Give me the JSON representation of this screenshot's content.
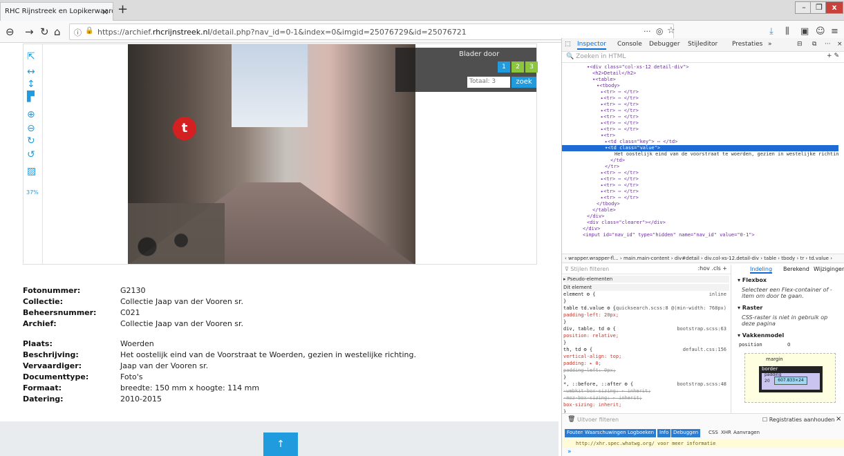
{
  "browser": {
    "tab_title": "RHC Rijnstreek en Lopikerwaard - D",
    "tab_close": "×",
    "new_tab": "+",
    "url_prefix": "https://archief.",
    "url_domain": "rhcrijnstreek.nl",
    "url_path": "/detail.php?nav_id=0-1&index=0&imgid=25076729&id=25076721",
    "page_actions": "···",
    "window": {
      "minimize": "–",
      "maximize": "❐",
      "close": "x"
    }
  },
  "viewer": {
    "zoom": "37%",
    "pager_title": "Blader door",
    "pages": [
      "1",
      "2",
      "3"
    ],
    "totaal": "Totaal: 3",
    "zoek": "zoek",
    "sign_letter": "t"
  },
  "details": [
    {
      "key": "Fotonummer:",
      "value": "G2130"
    },
    {
      "key": "Collectie:",
      "value": "Collectie Jaap van der Vooren sr."
    },
    {
      "key": "Beheersnummer:",
      "value": "C021"
    },
    {
      "key": "Archief:",
      "value": "Collectie Jaap van der Vooren sr."
    },
    {
      "key": "Plaats:",
      "value": "Woerden"
    },
    {
      "key": "Beschrijving:",
      "value": "Het oostelijk eind van de Voorstraat te Woerden, gezien in westelijke richting."
    },
    {
      "key": "Vervaardiger:",
      "value": "Jaap van der Vooren sr."
    },
    {
      "key": "Documenttype:",
      "value": "Foto's"
    },
    {
      "key": "Formaat:",
      "value": "breedte: 150 mm x hoogte: 114 mm"
    },
    {
      "key": "Datering:",
      "value": "2010-2015"
    }
  ],
  "footer": {
    "scroll_top": "↑"
  },
  "devtools": {
    "tabs": [
      "Inspector",
      "Console",
      "Debugger",
      "Stijleditor",
      "Prestaties",
      "»"
    ],
    "search_placeholder": "Zoeken in HTML",
    "markup": [
      "▾<div class=\"col-xs-12 detail-div\">",
      "<h2>Detail</h2>",
      "▾<table>",
      "▾<tbody>",
      "▸<tr> ⋯ </tr>",
      "▸<tr> ⋯ </tr>",
      "▸<tr> ⋯ </tr>",
      "▸<tr> ⋯ </tr>",
      "▸<tr> ⋯ </tr>",
      "▸<tr> ⋯ </tr>",
      "▸<tr> ⋯ </tr>",
      "▾<tr>",
      "▸<td class=\"key\"> ⋯ </td>",
      "▾<td class=\"value\">",
      "Het oostelijk eind van de voorstraat te woerden, gezien in westelijke richting.",
      "</td>",
      "</tr>",
      "▸<tr> ⋯ </tr>",
      "▸<tr> ⋯ </tr>",
      "▸<tr> ⋯ </tr>",
      "▸<tr> ⋯ </tr>",
      "▸<tr> ⋯ </tr>",
      "</tbody>",
      "</table>",
      "</div>",
      "<div class=\"clearer\"></div>",
      "</div>",
      "<input id=\"nav_id\" type=\"hidden\" name=\"nav_id\" value=\"0-1\">"
    ],
    "breadcrumbs": "‹ wrapper.wrapper-fl... › main.main-content › div#detail › div.col-xs-12.detail-div › table › tbody › tr › td.value ›",
    "rules_filter": "Stijlen filteren",
    "rules_tools": ":hov .cls +",
    "rules": [
      {
        "t": "hdr",
        "text": "▸ Pseudo-elementen"
      },
      {
        "t": "hdr",
        "text": "Dit element"
      },
      {
        "t": "code",
        "text": "element ⚙ {",
        "src": "inline"
      },
      {
        "t": "code",
        "text": "}"
      },
      {
        "t": "code",
        "text": "table td.value ⚙ {",
        "src": "_quicksearch.scss:8 @(min-width: 768px)"
      },
      {
        "t": "prop",
        "text": "  padding-left: 20px;"
      },
      {
        "t": "code",
        "text": "}"
      },
      {
        "t": "code",
        "text": "div, table, td ⚙ {",
        "src": "bootstrap.scss:63"
      },
      {
        "t": "prop",
        "text": "  position: relative;"
      },
      {
        "t": "code",
        "text": "}"
      },
      {
        "t": "code",
        "text": "th, td ⚙ {",
        "src": "default.css:156"
      },
      {
        "t": "prop",
        "text": "  vertical-align: top;"
      },
      {
        "t": "prop",
        "text": "  padding: ▸ 0;"
      },
      {
        "t": "strike",
        "text": "    padding-left: 0px;"
      },
      {
        "t": "code",
        "text": "}"
      },
      {
        "t": "code",
        "text": "*, ::before, ::after ⚙ {",
        "src": "bootstrap.scss:48"
      },
      {
        "t": "strike",
        "text": "  -webkit-box-sizing: ▸ inherit;"
      },
      {
        "t": "strike",
        "text": "  -moz-box-sizing: ▸ inherit;"
      },
      {
        "t": "prop",
        "text": "  box-sizing: inherit;"
      },
      {
        "t": "code",
        "text": "}"
      }
    ],
    "layout_tabs": [
      "Indeling",
      "Berekend",
      "Wijzigingen"
    ],
    "flexbox_title": "▾ Flexbox",
    "flexbox_note": "Selecteer een Flex-container of -item om door te gaan.",
    "raster_title": "▾ Raster",
    "raster_note": "CSS-raster is niet in gebruik op deze pagina",
    "boxmodel_title": "▾ Vakkenmodel",
    "position_label": "position",
    "position_value": "0",
    "margin_label": "margin",
    "border_label": "border",
    "padding_label": "padding",
    "content_size": "607.833×24",
    "padding_left": "20",
    "console_filter": "Uitvoer filteren",
    "console_persist": "Registraties aanhouden",
    "console_buttons": [
      "Fouten",
      "Waarschuwingen",
      "Logboeken",
      "Info",
      "Debuggen"
    ],
    "console_plain": [
      "CSS",
      "XHR",
      "Aanvragen"
    ],
    "console_message": "http://xhr.spec.whatwg.org/ voor meer informatie",
    "console_prompt": "»"
  },
  "colors": {
    "accent": "#1f9bde",
    "page_active": "#1f9bde",
    "page_green": "#8cc63f",
    "selection": "#1f6bd6"
  }
}
